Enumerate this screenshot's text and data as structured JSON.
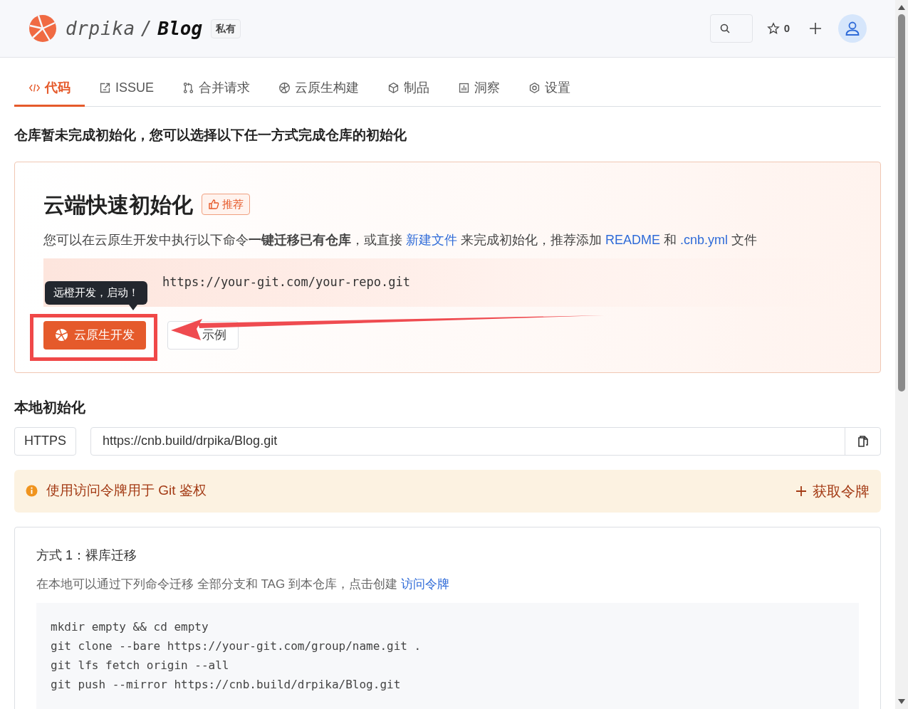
{
  "header": {
    "owner": "drpika",
    "separator": "/",
    "repo": "Blog",
    "visibility": "私有",
    "star_count": "0"
  },
  "tabs": [
    {
      "label": "代码",
      "selected": true
    },
    {
      "label": "ISSUE",
      "selected": false
    },
    {
      "label": "合并请求",
      "selected": false
    },
    {
      "label": "云原生构建",
      "selected": false
    },
    {
      "label": "制品",
      "selected": false
    },
    {
      "label": "洞察",
      "selected": false
    },
    {
      "label": "设置",
      "selected": false
    }
  ],
  "notice": "仓库暂未完成初始化，您可以选择以下任一方式完成仓库的初始化",
  "cloud_init": {
    "title": "云端快速初始化",
    "badge": "推荐",
    "description": [
      {
        "kind": "text",
        "text": "您可以在云原生开发中执行以下命令**一键迁移已有仓库**，或直接 "
      },
      {
        "kind": "link",
        "text": "新建文件"
      },
      {
        "kind": "text",
        "text": " 来完成初始化，推荐添加 "
      },
      {
        "kind": "link",
        "text": "README"
      },
      {
        "kind": "text",
        "text": " 和 "
      },
      {
        "kind": "link",
        "text": ".cnb.yml"
      },
      {
        "kind": "text",
        "text": " 文件"
      }
    ],
    "command": "https://your-git.com/your-repo.git",
    "tooltip": "远橙开发，启动！",
    "primary_button": "云原生开发",
    "secondary_button": "示例"
  },
  "local_init": {
    "title": "本地初始化",
    "protocol": "HTTPS",
    "url": "https://cnb.build/drpika/Blog.git",
    "alert": "使用访问令牌用于 Git 鉴权",
    "alert_action": "获取令牌",
    "method_title": "方式 1：裸库迁移",
    "method_description": [
      {
        "kind": "text",
        "text": "在本地可以通过下列命令迁移 全部分支和 TAG 到本仓库，点击创建 "
      },
      {
        "kind": "link",
        "text": "访问令牌"
      }
    ],
    "code_lines": [
      "mkdir empty && cd empty",
      "git clone --bare https://your-git.com/group/name.git .",
      "git lfs fetch origin --all",
      "git push --mirror https://cnb.build/drpika/Blog.git"
    ]
  }
}
